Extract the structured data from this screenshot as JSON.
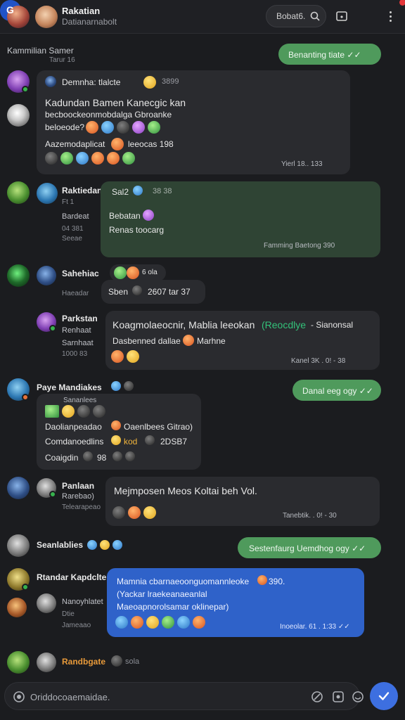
{
  "header": {
    "title": "Rakatian",
    "subtitle": "Datianarnabolt",
    "search_label": "Bobat6.",
    "profile_letter": "G"
  },
  "messages": {
    "m0": {
      "name": "Kammilian Samer",
      "meta": "Tarur 16",
      "pill": "Benanting tiate ✓✓"
    },
    "m1": {
      "header": "Demnha: tlalcte",
      "header_count": "3899",
      "line1": "Kadundan Bamen Kanecgic kan",
      "line2": "becboockeonmobdalga Gbroanke",
      "line3": "beloeode?",
      "line4": "Aazemodaplicat",
      "line4_tail": "leeocas 198",
      "ts": "Yierl 18.. 133"
    },
    "m2": {
      "name": "Raktiedan",
      "meta1": "Ft 1",
      "meta2": "Bardeat",
      "meta3": "04 381",
      "meta4": "Seeae",
      "top": "Sal2",
      "top_count": "38 38",
      "line1": "Bebatan",
      "line2": "Renas toocarg",
      "ts": "Famming Baetong 390"
    },
    "m3": {
      "name": "Sahehiac",
      "meta": "Haeadar",
      "react": "6 ola",
      "line": "Sben",
      "line_tail": "2607 tar 37"
    },
    "m4": {
      "name": "Parkstan",
      "meta1": "Renhaat",
      "meta2": "Sarnhaat",
      "meta3": "1000 83",
      "line1": "Koagmolaeocnir, Mablia leeokan",
      "line1_accent": "(Reocdlye",
      "line1_tail": "- Sianonsal",
      "line2": "Dasbenned dallae",
      "line2_tail": "Marhne",
      "ts": "Kanel 3K . 0! - 38"
    },
    "m5": {
      "name": "Paye Mandiakes",
      "pill": "Danal eeg ogy ✓✓",
      "small1": "Sananlees",
      "line1": "Daolianpeadao",
      "line1_tail": "Oaenlbees Gitrao)",
      "line2": "Comdanoedlins",
      "line2_tail": "kod",
      "line2_end": "2DSB7",
      "line3": "Coaigdin",
      "line3_tail": "98"
    },
    "m6": {
      "name": "Panlaan",
      "meta1": "Rarebao)",
      "meta2": "Telearapeao",
      "line1": "Mejmposen Meos Koltai beh Vol.",
      "ts": "Tanebtik. . 0! - 30"
    },
    "m7": {
      "name": "Seanlablies",
      "pill": "Sestenfaurg Uemdhog ogy ✓✓"
    },
    "m8": {
      "name": "Rtandar Kapdclte",
      "meta1": "Nanoyhlatet",
      "meta2": "Dtie",
      "meta3": "Jameaao",
      "line1": "Mamnia cbarnaeoonguomannleoke",
      "line1_tail": "390.",
      "line2": "(Yackar lraekeanaeanlal",
      "line3": "Maeoapnorolsamar oklinepar)",
      "ts": "Inoeolar. 61 . 1:33 ✓✓"
    },
    "m9": {
      "name": "Randbgate",
      "meta": "sola"
    }
  },
  "composer": {
    "placeholder": "Oriddocoaemaidae."
  },
  "colors": {
    "background": "#1b1c1f",
    "bubble_dark": "#2a2b2f",
    "bubble_green": "#2f4434",
    "pill_green": "#4f9a5c",
    "bubble_blue": "#2f62c9",
    "accent": "#3d6fe0"
  }
}
